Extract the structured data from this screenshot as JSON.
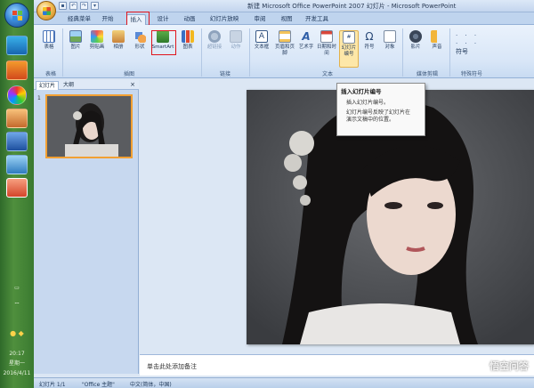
{
  "window": {
    "title": "新建 Microsoft Office PowerPoint 2007 幻灯片 - Microsoft PowerPoint"
  },
  "ribbon": {
    "tabs": [
      {
        "label": "经典菜单"
      },
      {
        "label": "开始"
      },
      {
        "label": "插入"
      },
      {
        "label": "设计"
      },
      {
        "label": "动画"
      },
      {
        "label": "幻灯片放映"
      },
      {
        "label": "审阅"
      },
      {
        "label": "视图"
      },
      {
        "label": "开发工具"
      }
    ],
    "buttons": {
      "table": "表格",
      "picture": "图片",
      "clipart": "剪贴画",
      "album": "相册",
      "shapes": "形状",
      "smartart": "SmartArt",
      "chart": "图表",
      "hyperlink": "超链接",
      "action": "动作",
      "textbox": "文本框",
      "header_footer": "页眉和页脚",
      "wordart": "艺术字",
      "datetime": "日期和时间",
      "slide_number": "幻灯片编号",
      "symbol": "符号",
      "object": "对象",
      "movie": "影片",
      "sound": "声音",
      "special_symbol": "符号"
    },
    "groups": {
      "tables": "表格",
      "illustrations": "插图",
      "links": "链接",
      "text": "文本",
      "media": "媒体剪辑",
      "special": "特殊符号"
    }
  },
  "tooltip": {
    "title": "插入幻灯片编号",
    "line1": "插入幻灯片编号。",
    "line2": "幻灯片编号反映了幻灯片在",
    "line3": "演示文稿中的位置。"
  },
  "panel": {
    "tab_slides": "幻灯片",
    "tab_outline": "大纲",
    "slide_number": "1"
  },
  "notes": {
    "placeholder": "单击此处添加备注"
  },
  "status": {
    "slide": "幻灯片 1/1",
    "theme": "\"Office 主题\"",
    "language": "中文(简体，中国)"
  },
  "taskbar": {
    "time": "20:17",
    "weekday": "星期一",
    "date": "2016/4/11"
  },
  "watermark": "悟空问答",
  "colors": {
    "highlight": "#e0141c",
    "ribbon": "#d8e6f7",
    "taskbar": "#3a7a30"
  }
}
